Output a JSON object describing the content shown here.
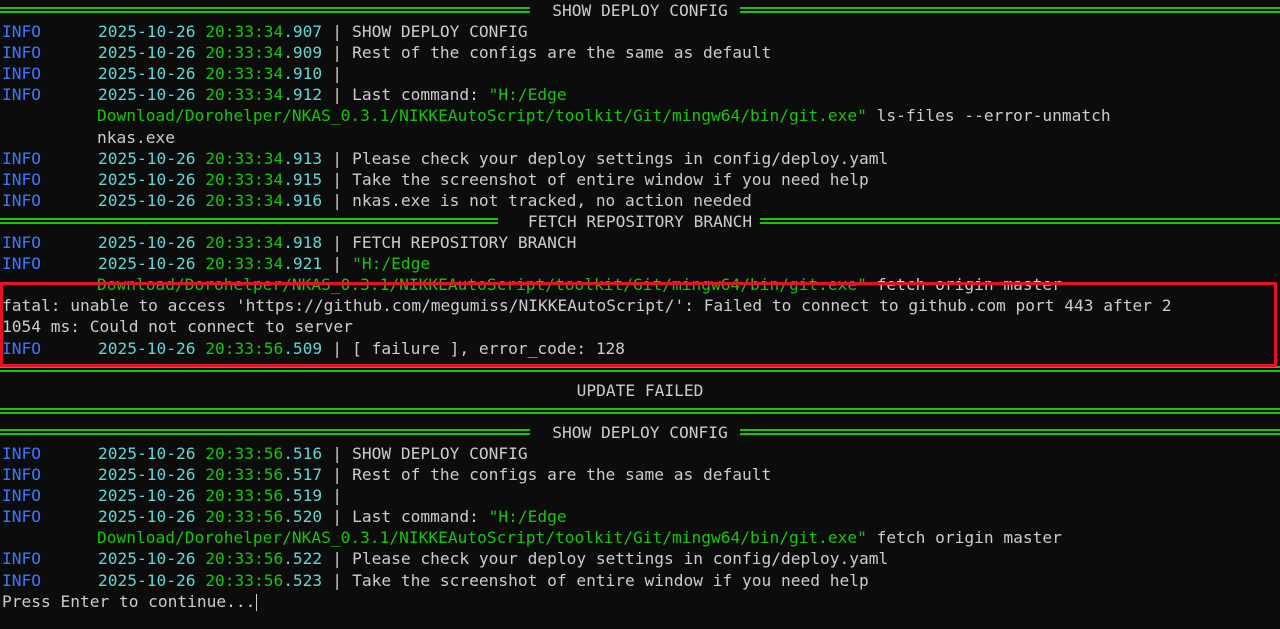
{
  "headers": {
    "show_deploy_config": "SHOW DEPLOY CONFIG",
    "fetch_repository_branch": "FETCH REPOSITORY BRANCH",
    "update_failed": "UPDATE FAILED"
  },
  "block1": [
    {
      "level": "INFO",
      "date": "2025-10-26",
      "time_a": "20:33:34",
      "time_b": ".907",
      "msg": "SHOW DEPLOY CONFIG"
    },
    {
      "level": "INFO",
      "date": "2025-10-26",
      "time_a": "20:33:34",
      "time_b": ".909",
      "msg": "Rest of the configs are the same as default"
    },
    {
      "level": "INFO",
      "date": "2025-10-26",
      "time_a": "20:33:34",
      "time_b": ".910",
      "msg": ""
    },
    {
      "level": "INFO",
      "date": "2025-10-26",
      "time_a": "20:33:34",
      "time_b": ".912",
      "msg": "Last command: ",
      "path": "\"H:/Edge"
    },
    {
      "path_cont": "Download/Dorohelper/NKAS_0.3.1/NIKKEAutoScript/toolkit/Git/mingw64/bin/git.exe\"",
      "rest": " ls-files --error-unmatch"
    },
    {
      "cont": "nkas.exe"
    },
    {
      "level": "INFO",
      "date": "2025-10-26",
      "time_a": "20:33:34",
      "time_b": ".913",
      "msg": "Please check your deploy settings in config/deploy.yaml"
    },
    {
      "level": "INFO",
      "date": "2025-10-26",
      "time_a": "20:33:34",
      "time_b": ".915",
      "msg": "Take the screenshot of entire window if you need help"
    },
    {
      "level": "INFO",
      "date": "2025-10-26",
      "time_a": "20:33:34",
      "time_b": ".916",
      "msg": "nkas.exe is not tracked, no action needed"
    }
  ],
  "block2": [
    {
      "level": "INFO",
      "date": "2025-10-26",
      "time_a": "20:33:34",
      "time_b": ".918",
      "msg": "FETCH REPOSITORY BRANCH"
    },
    {
      "level": "INFO",
      "date": "2025-10-26",
      "time_a": "20:33:34",
      "time_b": ".921",
      "msg": "",
      "path": "\"H:/Edge"
    },
    {
      "path_cont": "Download/Dorohelper/NKAS_0.3.1/NIKKEAutoScript/toolkit/Git/mingw64/bin/git.exe\"",
      "rest": " fetch origin master"
    },
    {
      "plain": "fatal: unable to access 'https://github.com/megumiss/NIKKEAutoScript/': Failed to connect to github.com port 443 after 2"
    },
    {
      "plain": "1054 ms: Could not connect to server"
    },
    {
      "level": "INFO",
      "date": "2025-10-26",
      "time_a": "20:33:56",
      "time_b": ".509",
      "msg": "[ failure ], error_code: 128"
    }
  ],
  "block3": [
    {
      "level": "INFO",
      "date": "2025-10-26",
      "time_a": "20:33:56",
      "time_b": ".516",
      "msg": "SHOW DEPLOY CONFIG"
    },
    {
      "level": "INFO",
      "date": "2025-10-26",
      "time_a": "20:33:56",
      "time_b": ".517",
      "msg": "Rest of the configs are the same as default"
    },
    {
      "level": "INFO",
      "date": "2025-10-26",
      "time_a": "20:33:56",
      "time_b": ".519",
      "msg": ""
    },
    {
      "level": "INFO",
      "date": "2025-10-26",
      "time_a": "20:33:56",
      "time_b": ".520",
      "msg": "Last command: ",
      "path": "\"H:/Edge"
    },
    {
      "path_cont": "Download/Dorohelper/NKAS_0.3.1/NIKKEAutoScript/toolkit/Git/mingw64/bin/git.exe\"",
      "rest": " fetch origin master"
    },
    {
      "level": "INFO",
      "date": "2025-10-26",
      "time_a": "20:33:56",
      "time_b": ".522",
      "msg": "Please check your deploy settings in config/deploy.yaml"
    },
    {
      "level": "INFO",
      "date": "2025-10-26",
      "time_a": "20:33:56",
      "time_b": ".523",
      "msg": "Take the screenshot of entire window if you need help"
    }
  ],
  "prompt": "Press Enter to continue...",
  "colors": {
    "background": "#0c0c0c",
    "info": "#3b78ff",
    "date": "#61d6d6",
    "time": "#16c60c",
    "rule": "#16c60c",
    "highlight": "#e81123",
    "text": "#cccccc"
  }
}
